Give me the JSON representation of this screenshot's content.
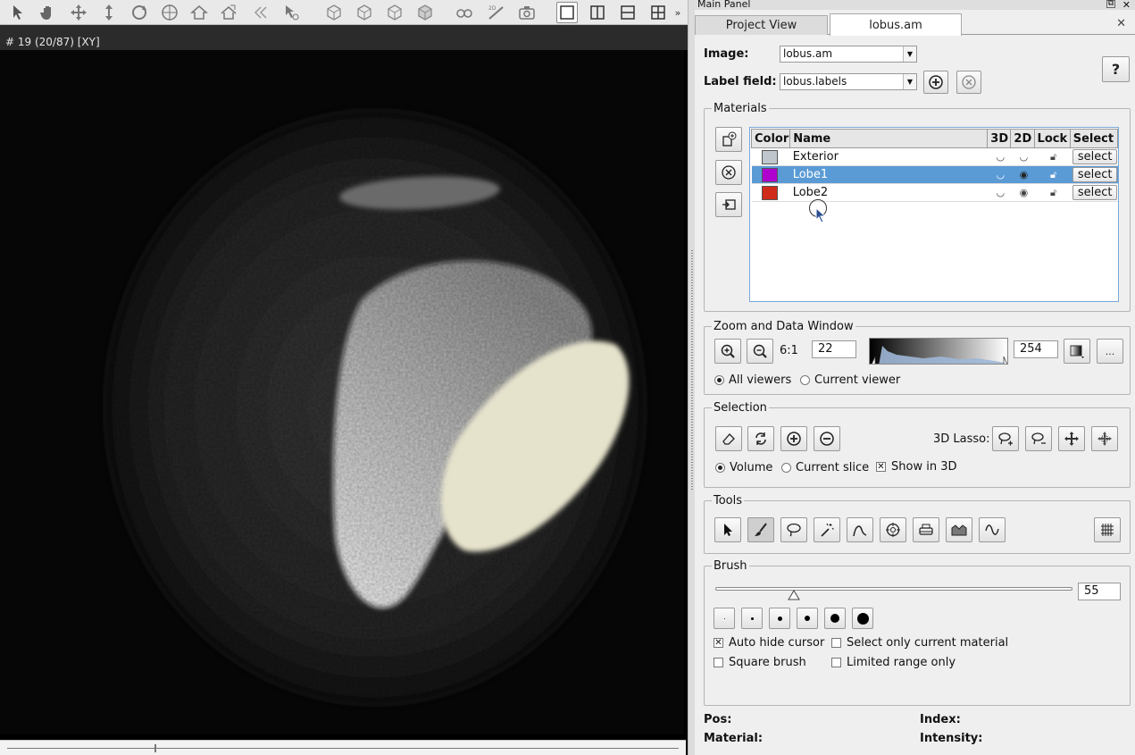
{
  "viewer": {
    "slice_label": "# 19 (20/87) [XY]"
  },
  "toolbar": {
    "icons": [
      "pointer-icon",
      "hand-icon",
      "move-icon",
      "vertical-move-icon",
      "rotate-icon",
      "target-icon",
      "home-icon",
      "set-home-icon",
      "previous-view-icon",
      "pick-icon",
      "view-xy-icon",
      "view-xz-icon",
      "view-yz-icon",
      "view-3d-icon",
      "stereo-icon",
      "measure-2d-icon",
      "snapshot-icon",
      "layout-single-icon",
      "layout-two-vertical-icon",
      "layout-two-horizontal-icon",
      "layout-four-icon"
    ],
    "more_label": "»"
  },
  "panel": {
    "window_title": "Main Panel",
    "tabs": [
      {
        "label": "Project View"
      },
      {
        "label": "lobus.am"
      }
    ],
    "image_label": "Image:",
    "image_value": "lobus.am",
    "labelfield_label": "Label field:",
    "labelfield_value": "lobus.labels",
    "help_label": "?"
  },
  "materials": {
    "title": "Materials",
    "columns": [
      "Color",
      "Name",
      "3D",
      "2D",
      "Lock",
      "Select"
    ],
    "rows": [
      {
        "name": "Exterior",
        "color": "#bfc7cc",
        "select": "select"
      },
      {
        "name": "Lobe1",
        "color": "#b000d0",
        "select": "select"
      },
      {
        "name": "Lobe2",
        "color": "#d02a1a",
        "select": "select"
      }
    ]
  },
  "zoom": {
    "title": "Zoom and Data Window",
    "ratio": "6:1",
    "min_value": "22",
    "max_value": "254",
    "more_label": "...",
    "all_viewers": "All viewers",
    "current_viewer": "Current viewer"
  },
  "selection": {
    "title": "Selection",
    "lasso_label": "3D Lasso:",
    "volume": "Volume",
    "current_slice": "Current slice",
    "show_3d": "Show in 3D"
  },
  "tools": {
    "title": "Tools",
    "icons": [
      "pointer-tool-icon",
      "brush-tool-icon",
      "lasso-tool-icon",
      "magic-wand-icon",
      "propagating-contour-icon",
      "blow-tool-icon",
      "threshold-tool-icon",
      "top-hat-icon",
      "snakes-icon"
    ]
  },
  "brush": {
    "title": "Brush",
    "size_value": "55",
    "size_fraction": 0.22,
    "auto_hide": "Auto hide cursor",
    "select_current": "Select only current material",
    "square_brush": "Square brush",
    "limited_range": "Limited range only"
  },
  "footer": {
    "pos": "Pos:",
    "index": "Index:",
    "material": "Material:",
    "intensity": "Intensity:"
  }
}
